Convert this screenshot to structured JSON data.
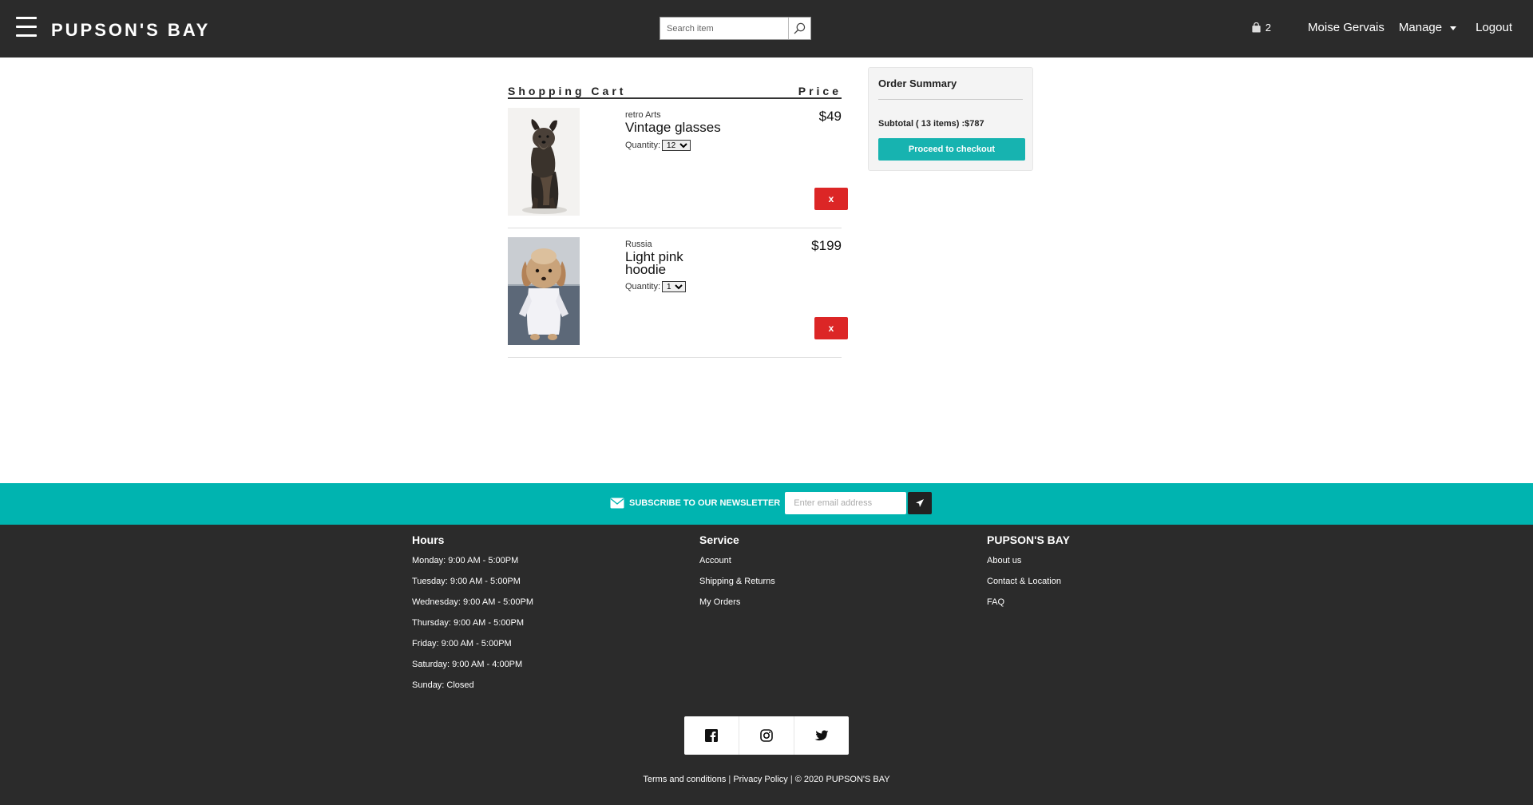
{
  "header": {
    "brand": "PUPSON'S BAY",
    "search_placeholder": "Search item",
    "cart_count": "2",
    "user_name": "Moise Gervais",
    "manage_label": "Manage",
    "logout_label": "Logout"
  },
  "cart": {
    "title": "Shopping Cart",
    "price_header": "Price",
    "items": [
      {
        "origin": "retro Arts",
        "name": "Vintage glasses",
        "quantity_label": "Quantity:",
        "quantity": "12",
        "price": "$49",
        "remove_label": "x"
      },
      {
        "origin": "Russia",
        "name": "Light pink hoodie",
        "quantity_label": "Quantity:",
        "quantity": "1",
        "price": "$199",
        "remove_label": "x"
      }
    ]
  },
  "summary": {
    "title": "Order Summary",
    "subtotal": "Subtotal ( 13 items) :$787",
    "checkout_label": "Proceed to checkout"
  },
  "newsletter": {
    "label": "SUBSCRIBE TO OUR NEWSLETTER",
    "placeholder": "Enter email address"
  },
  "footer": {
    "hours": {
      "title": "Hours",
      "lines": [
        "Monday: 9:00 AM - 5:00PM",
        "Tuesday: 9:00 AM - 5:00PM",
        "Wednesday: 9:00 AM - 5:00PM",
        "Thursday: 9:00 AM - 5:00PM",
        "Friday: 9:00 AM - 5:00PM",
        "Saturday: 9:00 AM - 4:00PM",
        "Sunday: Closed"
      ]
    },
    "service": {
      "title": "Service",
      "links": [
        "Account",
        "Shipping & Returns",
        "My Orders"
      ]
    },
    "company": {
      "title": "PUPSON'S BAY",
      "links": [
        "About us",
        "Contact & Location",
        "FAQ"
      ]
    },
    "social_icons": [
      "facebook-icon",
      "instagram-icon",
      "twitter-icon"
    ],
    "legal": {
      "terms": "Terms and conditions",
      "privacy": "Privacy Policy",
      "copyright": "© 2020 PUPSON'S BAY"
    }
  },
  "colors": {
    "header_bg": "#2b2b2b",
    "accent_teal": "#00b4b0",
    "remove_red": "#dc2626"
  }
}
